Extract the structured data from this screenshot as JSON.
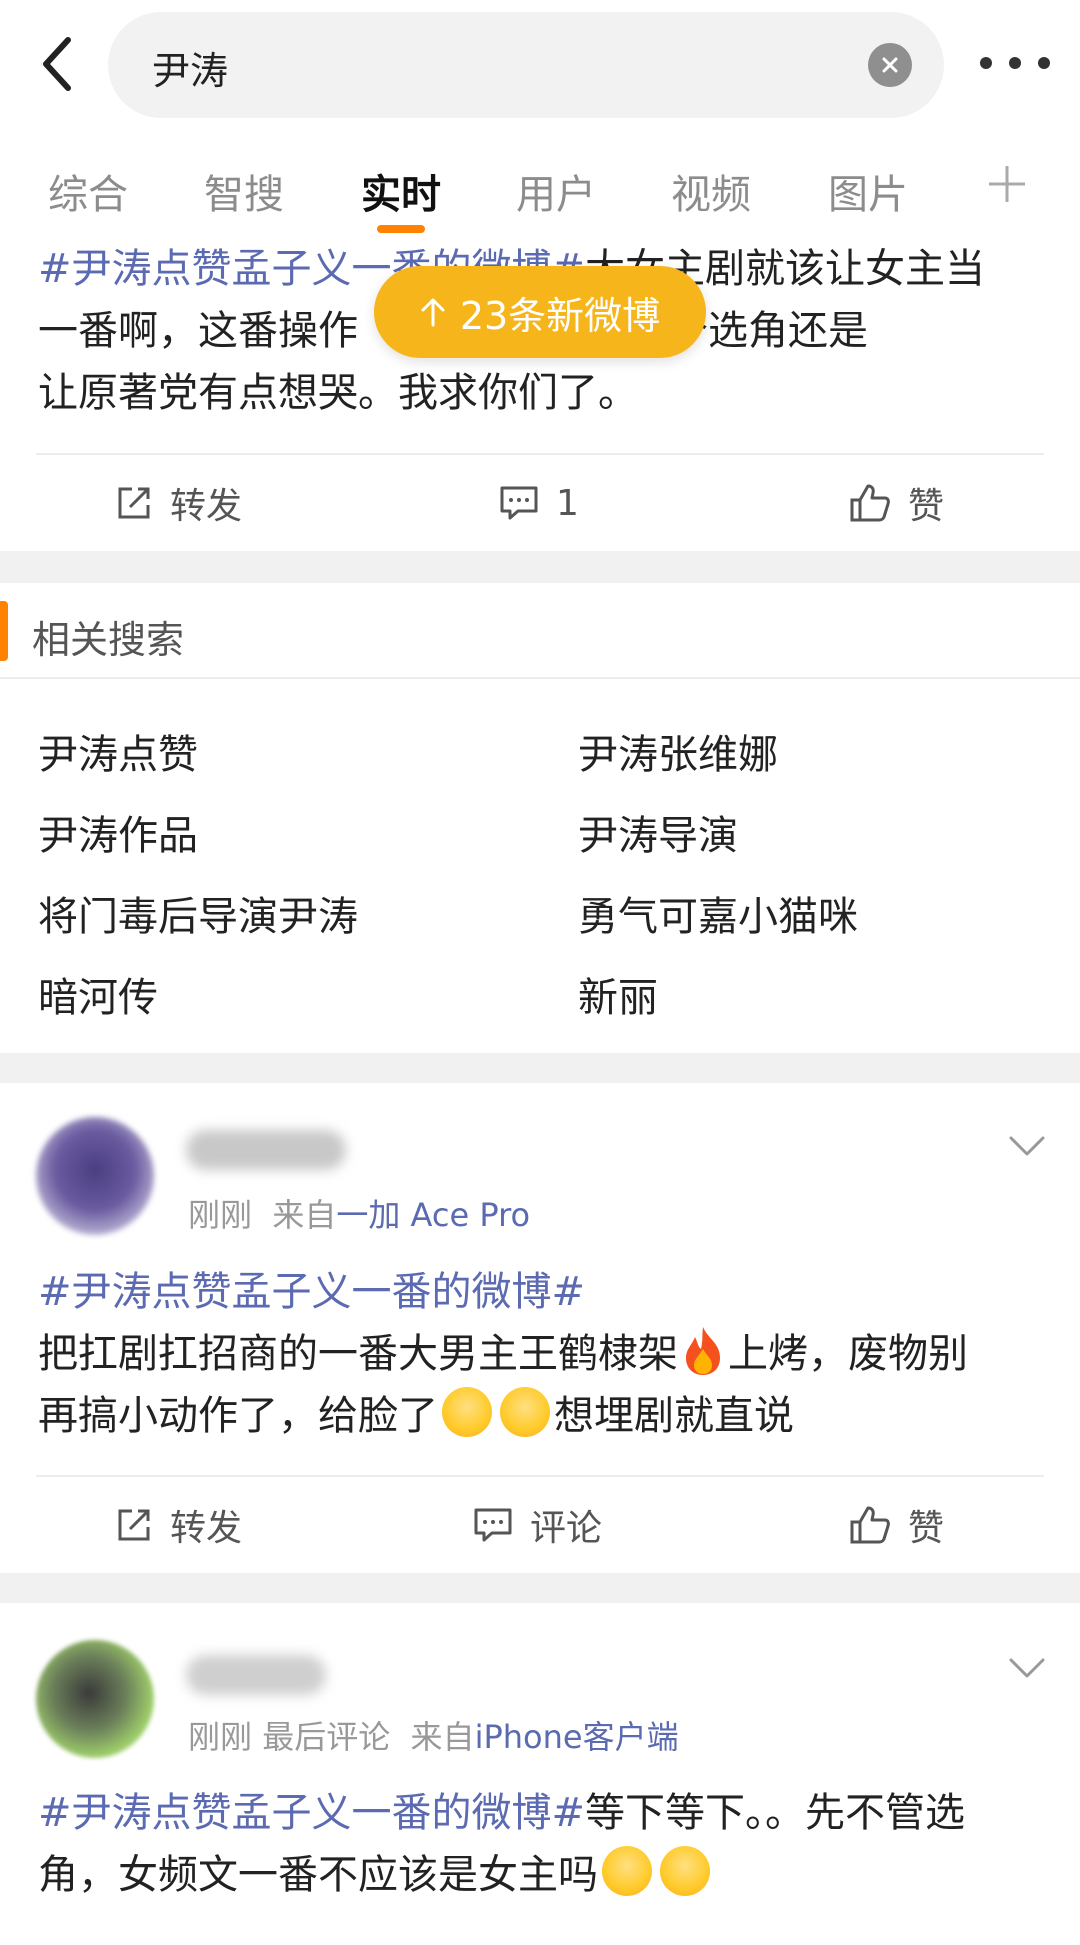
{
  "search": {
    "query": "尹涛"
  },
  "tabs": [
    "综合",
    "智搜",
    "实时",
    "用户",
    "视频",
    "图片"
  ],
  "toast": {
    "text": "23条新微博"
  },
  "post1": {
    "topic": "#尹涛点赞孟子义一番的微博#",
    "line1_rest": "大女主剧就该让女主当",
    "line2a": "一番啊，这番操作",
    "line2b": "是，这个选角还是",
    "line3": "让原著党有点想哭。我求你们了。",
    "repost_label": "转发",
    "comment_count": "1",
    "like_label": "赞"
  },
  "related": {
    "title": "相关搜索",
    "items": [
      "尹涛点赞",
      "尹涛张维娜",
      "尹涛作品",
      "尹涛导演",
      "将门毒后导演尹涛",
      "勇气可嘉小猫咪",
      "暗河传",
      "新丽"
    ]
  },
  "post2": {
    "time": "刚刚",
    "from_prefix": "来自",
    "source": "一加 Ace Pro",
    "topic": "#尹涛点赞孟子义一番的微博#",
    "line2a": "把扛剧扛招商的一番大男主王鹤棣架",
    "line2b": "上烤，废物别",
    "line3a": "再搞小动作了，给脸了",
    "line3b": "想埋剧就直说",
    "repost_label": "转发",
    "comment_label": "评论",
    "like_label": "赞"
  },
  "post3": {
    "time": "刚刚",
    "last_comment": "最后评论",
    "from_prefix": "来自",
    "source": "iPhone客户端",
    "topic": "#尹涛点赞孟子义一番的微博#",
    "line1_rest": "等下等下。。先不管选",
    "line2": "角，女频文一番不应该是女主吗"
  },
  "colors": {
    "accent": "#ff8200",
    "topic": "#5b6ab1",
    "toast": "#f7b51c"
  }
}
